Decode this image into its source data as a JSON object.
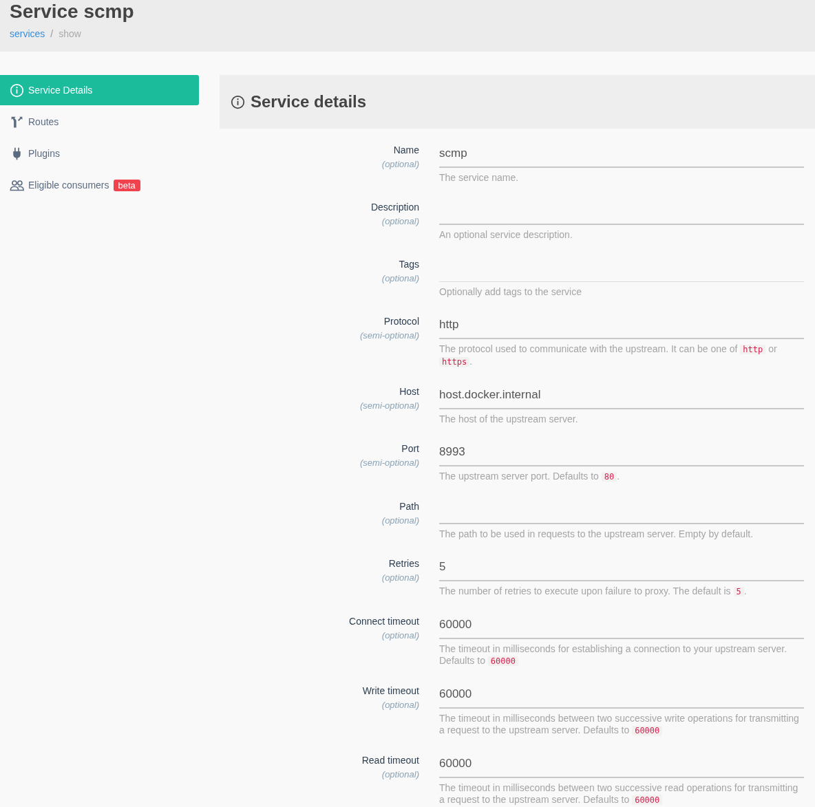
{
  "page": {
    "title": "Service scmp"
  },
  "breadcrumb": {
    "separator": "/",
    "items": [
      {
        "label": "services",
        "current": false
      },
      {
        "label": "show",
        "current": true
      }
    ]
  },
  "sidebar": {
    "items": [
      {
        "label": "Service Details",
        "selected": true
      },
      {
        "label": "Routes",
        "selected": false
      },
      {
        "label": "Plugins",
        "selected": false
      },
      {
        "label": "Eligible consumers",
        "selected": false,
        "badge": "beta"
      }
    ]
  },
  "panel": {
    "title": "Service details"
  },
  "fields": [
    {
      "label": "Name",
      "hint": "(optional)",
      "kind": "text",
      "value": "scmp",
      "help": [
        {
          "kind": "text",
          "text": "The service name."
        }
      ]
    },
    {
      "label": "Description",
      "hint": "(optional)",
      "kind": "text",
      "help": [
        {
          "kind": "text",
          "text": "An optional service description."
        }
      ]
    },
    {
      "label": "Tags",
      "hint": "(optional)",
      "kind": "tags",
      "help": [
        {
          "kind": "text",
          "text": "Optionally add tags to the service"
        }
      ]
    },
    {
      "label": "Protocol",
      "hint": "(semi-optional)",
      "kind": "text",
      "value": "http",
      "help": [
        {
          "kind": "text",
          "text": "The protocol used to communicate with the upstream. It can be one of "
        },
        {
          "kind": "code",
          "text": "http"
        },
        {
          "kind": "text",
          "text": " or "
        },
        {
          "kind": "code",
          "text": "https"
        },
        {
          "kind": "text",
          "text": "."
        }
      ]
    },
    {
      "label": "Host",
      "hint": "(semi-optional)",
      "kind": "text",
      "value": "host.docker.internal",
      "help": [
        {
          "kind": "text",
          "text": "The host of the upstream server."
        }
      ]
    },
    {
      "label": "Port",
      "hint": "(semi-optional)",
      "kind": "text",
      "value": "8993",
      "help": [
        {
          "kind": "text",
          "text": "The upstream server port. Defaults to "
        },
        {
          "kind": "code",
          "text": "80"
        },
        {
          "kind": "text",
          "text": "."
        }
      ]
    },
    {
      "label": "Path",
      "hint": "(optional)",
      "kind": "text",
      "help": [
        {
          "kind": "text",
          "text": "The path to be used in requests to the upstream server. Empty by default."
        }
      ]
    },
    {
      "label": "Retries",
      "hint": "(optional)",
      "kind": "text",
      "value": "5",
      "help": [
        {
          "kind": "text",
          "text": "The number of retries to execute upon failure to proxy. The default is "
        },
        {
          "kind": "code",
          "text": "5"
        },
        {
          "kind": "text",
          "text": "."
        }
      ]
    },
    {
      "label": "Connect timeout",
      "hint": "(optional)",
      "kind": "text",
      "value": "60000",
      "help": [
        {
          "kind": "text",
          "text": "The timeout in milliseconds for establishing a connection to your upstream server. Defaults to "
        },
        {
          "kind": "code",
          "text": "60000"
        }
      ]
    },
    {
      "label": "Write timeout",
      "hint": "(optional)",
      "kind": "text",
      "value": "60000",
      "help": [
        {
          "kind": "text",
          "text": "The timeout in milliseconds between two successive write operations for transmitting a request to the upstream server. Defaults to "
        },
        {
          "kind": "code",
          "text": "60000"
        }
      ]
    },
    {
      "label": "Read timeout",
      "hint": "(optional)",
      "kind": "text",
      "value": "60000",
      "help": [
        {
          "kind": "text",
          "text": "The timeout in milliseconds between two successive read operations for transmitting a request to the upstream server. Defaults to "
        },
        {
          "kind": "code",
          "text": "60000"
        }
      ]
    }
  ]
}
